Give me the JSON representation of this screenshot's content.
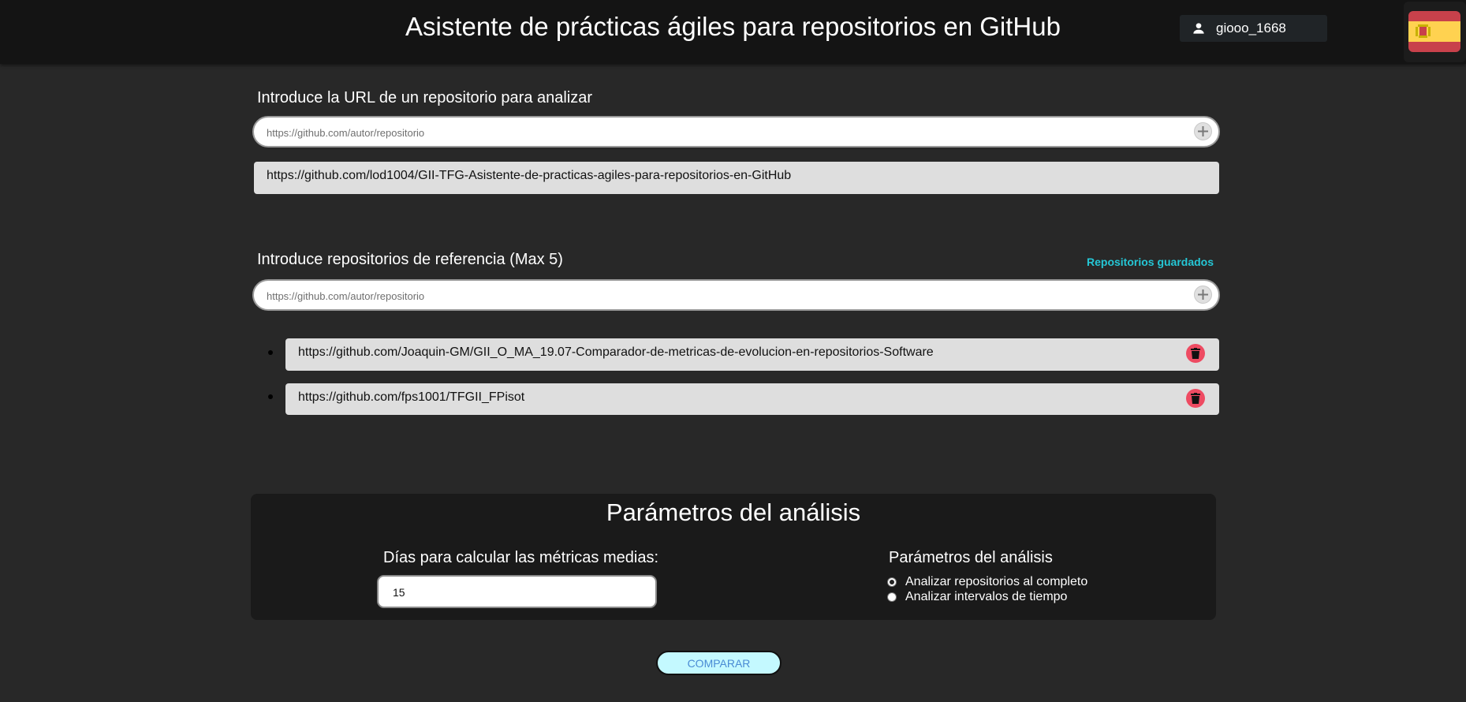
{
  "header": {
    "title": "Asistente de prácticas ágiles para repositorios en GitHub",
    "username": "giooo_1668",
    "language_flag": "spain-flag-icon"
  },
  "main_repo": {
    "label": "Introduce la URL de un repositorio para analizar",
    "input_placeholder": "https://github.com/autor/repositorio",
    "input_value": "",
    "selected_url": "https://github.com/lod1004/GII-TFG-Asistente-de-practicas-agiles-para-repositorios-en-GitHub"
  },
  "reference_repos": {
    "label": "Introduce repositorios de referencia (Max 5)",
    "saved_link": "Repositorios guardados",
    "input_placeholder": "https://github.com/autor/repositorio",
    "input_value": "",
    "items": [
      {
        "url": "https://github.com/Joaquin-GM/GII_O_MA_19.07-Comparador-de-metricas-de-evolucion-en-repositorios-Software"
      },
      {
        "url": "https://github.com/fps1001/TFGII_FPisot"
      }
    ]
  },
  "params": {
    "title": "Parámetros del análisis",
    "days_label": "Días para calcular las métricas medias:",
    "days_value": "15",
    "mode_label": "Parámetros del análisis",
    "options": [
      {
        "label": "Analizar repositorios al completo",
        "checked": true
      },
      {
        "label": "Analizar intervalos de tiempo",
        "checked": false
      }
    ]
  },
  "actions": {
    "compare_label": "COMPARAR"
  },
  "colors": {
    "background": "#282828",
    "topbar": "#141414",
    "accent_link": "#25c7d6",
    "delete": "#ee4b62",
    "compare_bg": "#c4f9ff"
  }
}
